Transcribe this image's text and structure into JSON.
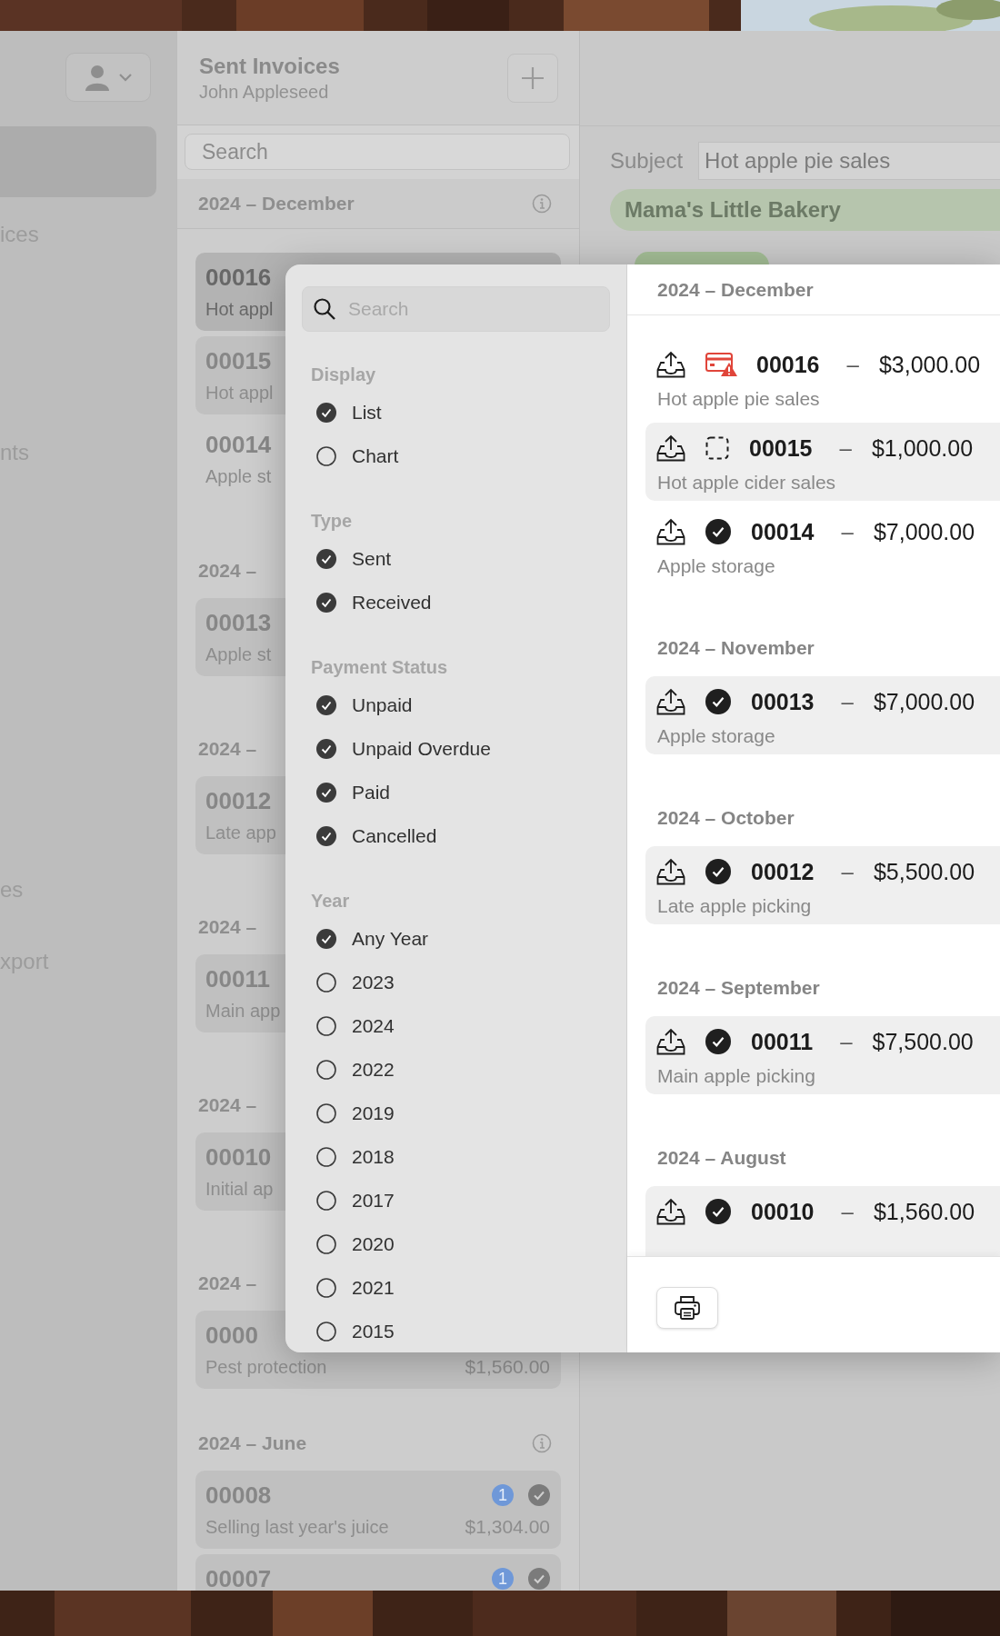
{
  "sidebar": {
    "items": [
      {
        "selected": true
      },
      {
        "label": "ices",
        "selected": false
      },
      {
        "label": "nts",
        "selected": false
      },
      {
        "label": "es",
        "selected": false
      },
      {
        "label": "xport",
        "selected": false
      }
    ]
  },
  "list_header": {
    "title": "Sent Invoices",
    "subtitle": "John Appleseed"
  },
  "search": {
    "placeholder": "Search"
  },
  "list": {
    "sections": [
      {
        "header": "2024 – December",
        "info": true,
        "invoices": [
          {
            "number": "00016",
            "subject": "Hot appl",
            "selected": true
          },
          {
            "number": "00015",
            "subject": "Hot appl",
            "selected": false,
            "highlighted": true
          },
          {
            "number": "00014",
            "subject": "Apple st",
            "selected": false,
            "highlighted": false
          }
        ]
      },
      {
        "header": "2024 –",
        "invoices": [
          {
            "number": "00013",
            "subject": "Apple st",
            "selected": false,
            "highlighted": true
          }
        ]
      },
      {
        "header": "2024 –",
        "invoices": [
          {
            "number": "00012",
            "subject": "Late app",
            "selected": false,
            "highlighted": true
          }
        ]
      },
      {
        "header": "2024 –",
        "invoices": [
          {
            "number": "00011",
            "subject": "Main app",
            "selected": false,
            "highlighted": true
          }
        ]
      },
      {
        "header": "2024 –",
        "invoices": [
          {
            "number": "00010",
            "subject": "Initial ap",
            "selected": false,
            "highlighted": true
          }
        ]
      },
      {
        "header": "2024 –",
        "invoices": [
          {
            "number": "0000",
            "subject": "Pest protection",
            "amount": "$1,560.00",
            "selected": false,
            "highlighted": true
          }
        ]
      },
      {
        "header": "2024 – June",
        "info": true,
        "invoices": [
          {
            "number": "00008",
            "subject": "Selling last year's juice",
            "amount": "$1,304.00",
            "badge": "1",
            "paid": true,
            "selected": false,
            "highlighted": true
          },
          {
            "number": "00007",
            "badge": "1",
            "paid": true,
            "selected": false,
            "highlighted": true
          }
        ]
      }
    ]
  },
  "detail": {
    "subject_label": "Subject",
    "subject_value": "Hot apple pie sales",
    "client": "Mama's Little Bakery"
  },
  "filter_popup": {
    "search": {
      "placeholder": "Search"
    },
    "groups": [
      {
        "title": "Display",
        "options": [
          {
            "label": "List",
            "checked": true
          },
          {
            "label": "Chart",
            "checked": false
          }
        ]
      },
      {
        "title": "Type",
        "options": [
          {
            "label": "Sent",
            "checked": true
          },
          {
            "label": "Received",
            "checked": true
          }
        ]
      },
      {
        "title": "Payment Status",
        "options": [
          {
            "label": "Unpaid",
            "checked": true
          },
          {
            "label": "Unpaid Overdue",
            "checked": true
          },
          {
            "label": "Paid",
            "checked": true
          },
          {
            "label": "Cancelled",
            "checked": true
          }
        ]
      },
      {
        "title": "Year",
        "options": [
          {
            "label": "Any Year",
            "checked": true
          },
          {
            "label": "2023",
            "checked": false
          },
          {
            "label": "2024",
            "checked": false
          },
          {
            "label": "2022",
            "checked": false
          },
          {
            "label": "2019",
            "checked": false
          },
          {
            "label": "2018",
            "checked": false
          },
          {
            "label": "2017",
            "checked": false
          },
          {
            "label": "2020",
            "checked": false
          },
          {
            "label": "2021",
            "checked": false
          },
          {
            "label": "2015",
            "checked": false
          }
        ]
      }
    ],
    "results": {
      "sections": [
        {
          "header": "2024 – December",
          "invoices": [
            {
              "number": "00016",
              "separator": "–",
              "amount": "$3,000.00",
              "subject": "Hot apple pie sales",
              "kind": "overdue",
              "highlighted": false
            },
            {
              "number": "00015",
              "separator": "–",
              "amount": "$1,000.00",
              "subject": "Hot apple cider sales",
              "kind": "draft",
              "highlighted": true
            },
            {
              "number": "00014",
              "separator": "–",
              "amount": "$7,000.00",
              "subject": "Apple storage",
              "kind": "paid",
              "highlighted": false
            }
          ]
        },
        {
          "header": "2024 – November",
          "invoices": [
            {
              "number": "00013",
              "separator": "–",
              "amount": "$7,000.00",
              "subject": "Apple storage",
              "kind": "paid",
              "highlighted": true
            }
          ]
        },
        {
          "header": "2024 – October",
          "invoices": [
            {
              "number": "00012",
              "separator": "–",
              "amount": "$5,500.00",
              "subject": "Late apple picking",
              "kind": "paid",
              "highlighted": true
            }
          ]
        },
        {
          "header": "2024 – September",
          "invoices": [
            {
              "number": "00011",
              "separator": "–",
              "amount": "$7,500.00",
              "subject": "Main apple picking",
              "kind": "paid",
              "highlighted": true
            }
          ]
        },
        {
          "header": "2024 – August",
          "invoices": [
            {
              "number": "00010",
              "separator": "–",
              "amount": "$1,560.00",
              "kind": "paid",
              "highlighted": true
            }
          ]
        }
      ]
    }
  }
}
